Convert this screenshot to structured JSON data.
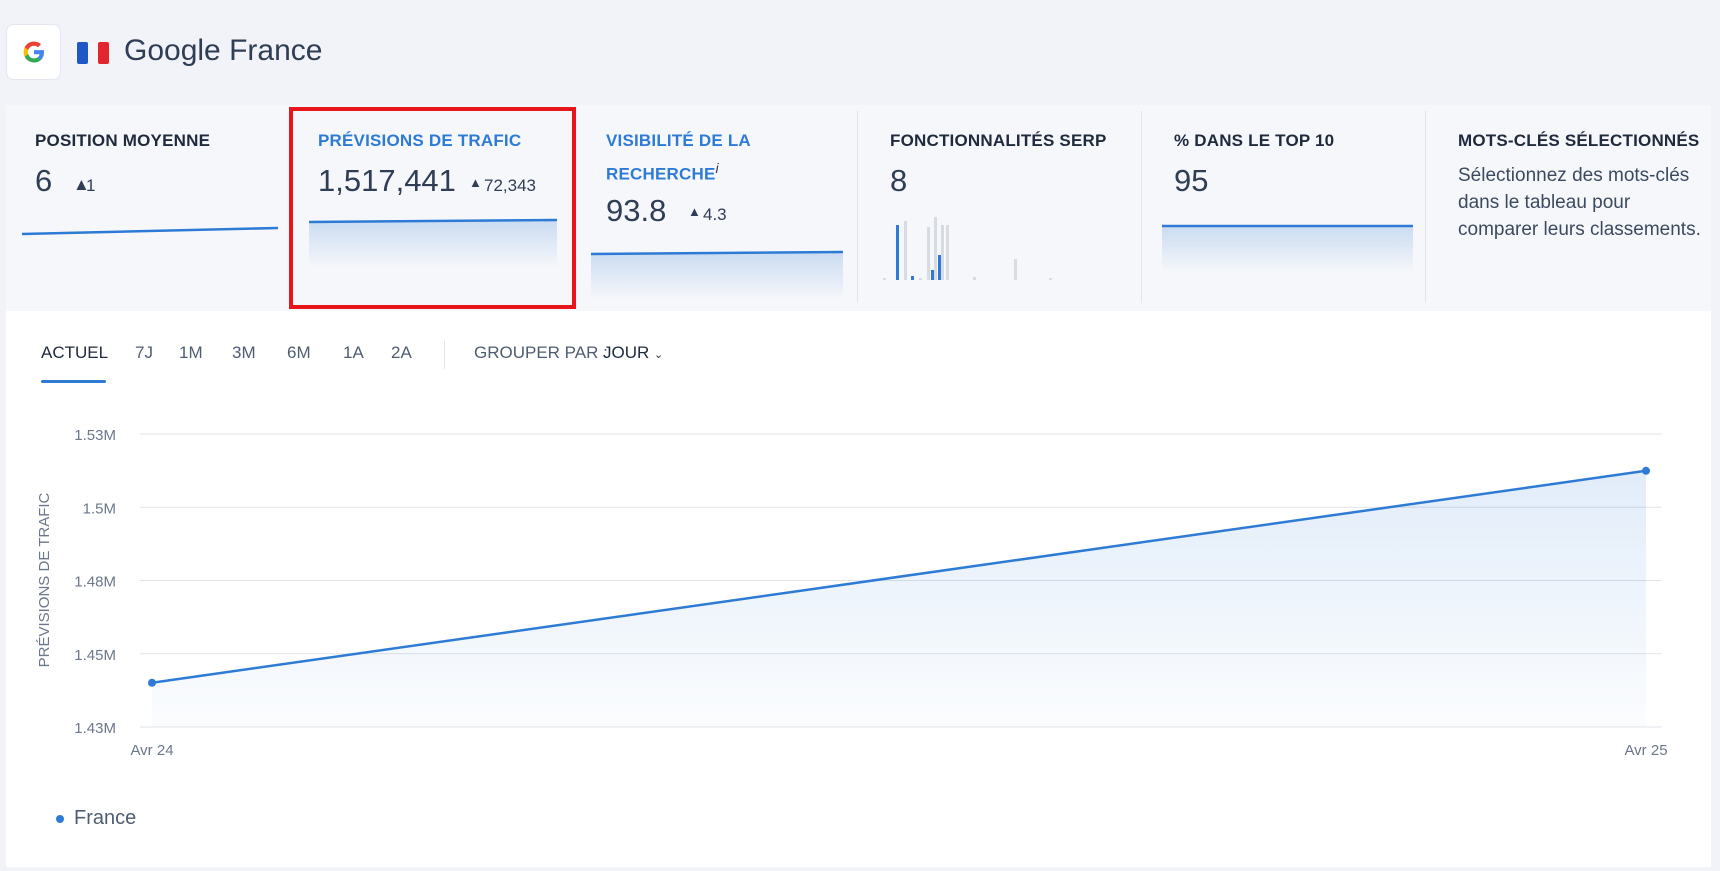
{
  "engine": {
    "title": "Google France",
    "logo_letter": "G"
  },
  "cards": [
    {
      "title": "POSITION MOYENNE",
      "value": "6",
      "delta": "1"
    },
    {
      "title": "PRÉVISIONS DE TRAFIC",
      "value": "1,517,441",
      "delta": "72,343",
      "selected": true
    },
    {
      "title_line1": "VISIBILITÉ DE LA",
      "title_line2": "RECHERCHE",
      "info": "i",
      "value": "93.8",
      "delta": "4.3"
    },
    {
      "title": "FONCTIONNALITÉS SERP",
      "value": "8"
    },
    {
      "title": "% DANS LE TOP 10",
      "value": "95"
    },
    {
      "title": "MOTS-CLÉS SÉLECTIONNÉS",
      "description": "Sélectionnez des mots-clés dans le tableau pour comparer leurs classements."
    }
  ],
  "tabs": [
    "ACTUEL",
    "7J",
    "1M",
    "3M",
    "6M",
    "1A",
    "2A"
  ],
  "active_tab": "ACTUEL",
  "group_by": {
    "label": "GROUPER PAR :",
    "value": "JOUR"
  },
  "colors": {
    "accent": "#2e7bd5",
    "highlight": "#e8161b"
  },
  "chart_data": {
    "type": "area",
    "ylabel": "PRÉVISIONS DE TRAFIC",
    "yticks": [
      "1.53M",
      "1.5M",
      "1.48M",
      "1.45M",
      "1.43M"
    ],
    "ylim": [
      1430000,
      1530000
    ],
    "grid": true,
    "x": [
      "Avr 24",
      "Avr 25"
    ],
    "series": [
      {
        "name": "France",
        "values": [
          1445098,
          1517441
        ]
      }
    ],
    "legend": "bottom-left"
  }
}
